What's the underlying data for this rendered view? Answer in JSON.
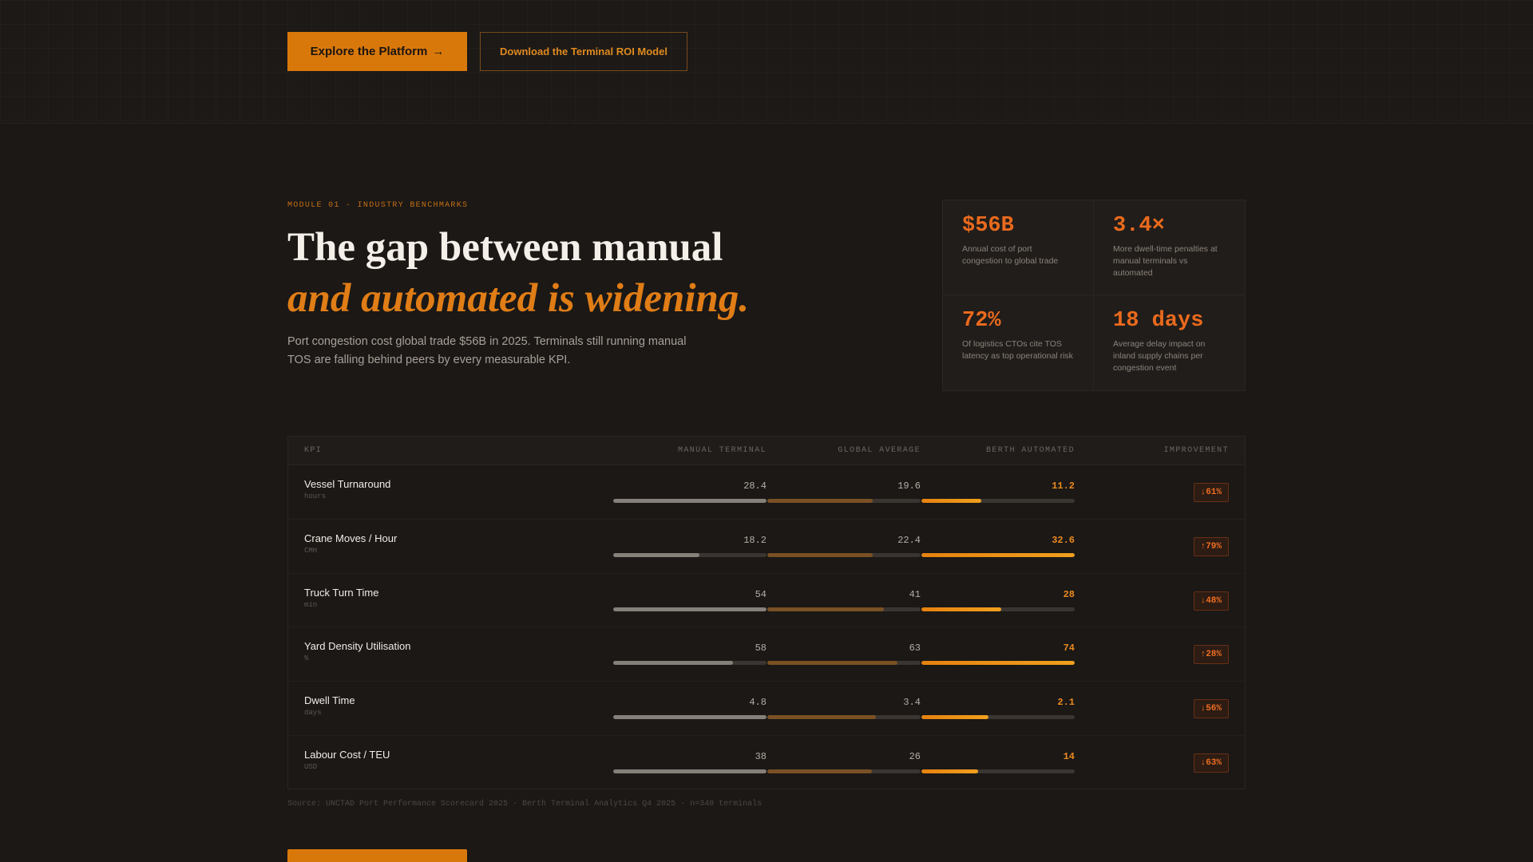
{
  "hero_actions": {
    "primary_label": "Explore the Platform",
    "primary_arrow": "→",
    "secondary_label": "Download the Terminal ROI Model"
  },
  "module": {
    "eyebrow": "MODULE 01 · INDUSTRY BENCHMARKS",
    "headline_line1": "The gap between manual",
    "headline_line2": "and automated is widening.",
    "lede": "Port congestion cost global trade $56B in 2025. Terminals still running manual TOS are falling behind peers by every measurable KPI."
  },
  "stats": [
    {
      "value": "$56B",
      "desc": "Annual cost of port congestion to global trade"
    },
    {
      "value": "3.4×",
      "desc": "More dwell-time penalties at manual terminals vs automated"
    },
    {
      "value": "72%",
      "desc": "Of logistics CTOs cite TOS latency as top operational risk"
    },
    {
      "value": "18 days",
      "desc": "Average delay impact on inland supply chains per congestion event"
    }
  ],
  "table": {
    "headers": {
      "kpi": "KPI",
      "manual": "MANUAL TERMINAL",
      "global": "GLOBAL AVERAGE",
      "berth": "BERTH AUTOMATED",
      "improvement": "IMPROVEMENT"
    },
    "rows": [
      {
        "name": "Vessel Turnaround",
        "unit": "hours",
        "manual": "28.4",
        "global": "19.6",
        "berth": "11.2",
        "improvement": "↓61%",
        "manual_level": 1.0,
        "global_level": 0.69,
        "berth_level": 0.39
      },
      {
        "name": "Crane Moves / Hour",
        "unit": "CMH",
        "manual": "18.2",
        "global": "22.4",
        "berth": "32.6",
        "improvement": "↑79%",
        "manual_level": 0.56,
        "global_level": 0.69,
        "berth_level": 1.0
      },
      {
        "name": "Truck Turn Time",
        "unit": "min",
        "manual": "54",
        "global": "41",
        "berth": "28",
        "improvement": "↓48%",
        "manual_level": 1.0,
        "global_level": 0.76,
        "berth_level": 0.52
      },
      {
        "name": "Yard Density Utilisation",
        "unit": "%",
        "manual": "58",
        "global": "63",
        "berth": "74",
        "improvement": "↑28%",
        "manual_level": 0.78,
        "global_level": 0.85,
        "berth_level": 1.0
      },
      {
        "name": "Dwell Time",
        "unit": "days",
        "manual": "4.8",
        "global": "3.4",
        "berth": "2.1",
        "improvement": "↓56%",
        "manual_level": 1.0,
        "global_level": 0.71,
        "berth_level": 0.44
      },
      {
        "name": "Labour Cost / TEU",
        "unit": "USD",
        "manual": "38",
        "global": "26",
        "berth": "14",
        "improvement": "↓63%",
        "manual_level": 1.0,
        "global_level": 0.68,
        "berth_level": 0.37
      }
    ]
  },
  "source_note": "Source: UNCTAD Port Performance Scorecard 2025 · Berth Terminal Analytics Q4 2025 · n=340 terminals"
}
